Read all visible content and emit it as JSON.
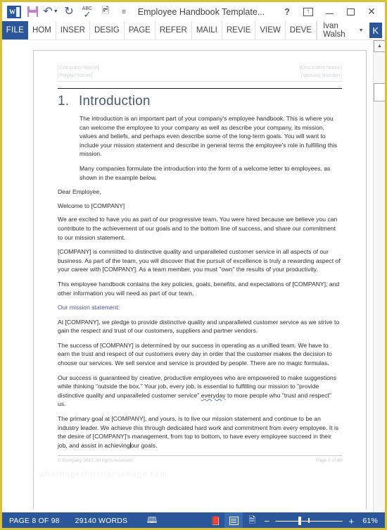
{
  "app": {
    "title": "Employee Handbook Template...",
    "quick_access": [
      {
        "name": "word-logo",
        "label": "W"
      },
      {
        "name": "save-icon",
        "label": "Save"
      },
      {
        "name": "undo-icon",
        "label": "Undo"
      },
      {
        "name": "redo-icon",
        "label": "Redo"
      },
      {
        "name": "spelling-icon",
        "label": "ABC"
      },
      {
        "name": "touch-mode-icon",
        "label": "Touch/Mouse Mode"
      },
      {
        "name": "customize-qat-icon",
        "label": "Customize Quick Access Toolbar"
      }
    ],
    "window_controls": [
      {
        "name": "help-button",
        "label": "?"
      },
      {
        "name": "ribbon-display-options-button",
        "label": "Ribbon Display Options"
      },
      {
        "name": "minimize-button",
        "label": "Minimize"
      },
      {
        "name": "maximize-button",
        "label": "Maximize"
      },
      {
        "name": "close-button",
        "label": "Close"
      }
    ]
  },
  "ribbon": {
    "file_tab": "FILE",
    "tabs": [
      "HOM",
      "INSER",
      "DESIG",
      "PAGE",
      "REFER",
      "MAILI",
      "REVIE",
      "VIEW",
      "DEVE"
    ],
    "user": "Ivan Walsh",
    "avatar_letter": "K"
  },
  "document": {
    "header": {
      "company": "[Company Name]",
      "project": "[Project Name]",
      "doc_name": "[Document Name]",
      "version": "[Version Number]"
    },
    "heading_number": "1.",
    "heading_text": "Introduction",
    "paragraphs": [
      "The introduction is an important part of your company's employee handbook. This is where you can welcome the employee to your company as well as describe your company, its mission, values and beliefs, and perhaps even describe some of the long-term goals. You will want to include your mission statement and describe in general terms the employee's role in fulfilling this mission.",
      "Many companies formulate the introduction into the form of a welcome letter to employees, as shown in the example below."
    ],
    "salutation": "Dear Employee,",
    "welcome": "Welcome to [COMPANY]",
    "body": [
      "We are excited to have you as part of our progressive team. You were hired because we believe you can contribute to the achievement of our goals and to the bottom line of success, and share our commitment to our mission statement.",
      "[COMPANY] is committed to distinctive quality and unparalleled customer service in all aspects of our business. As part of the team, you will discover that the pursuit of excellence is truly a rewarding aspect of your career with [COMPANY]. As a team member, you must \"own\" the results of your productivity.",
      "This employee handbook contains the key policies, goals, benefits, and expectations of [COMPANY]; and other information you will need as part of our team."
    ],
    "mission_label": "Our mission statement:",
    "mission_body": [
      "At [COMPANY], we pledge to provide distinctive quality and unparalleled customer service as we strive to gain the respect and trust of our customers, suppliers and partner vendors.",
      "The success of [COMPANY] is determined by our success in operating as a unified team. We have to earn the trust and respect of our customers every day in order that the customer makes the decision to choose our services. We sell service and service is provided by people. There are no magic formulas."
    ],
    "success_para_a": "Our success is guaranteed by creative, productive employees who are empowered to make suggestions while thinking \"outside the box.\" Your job, every job, is essential to fulfilling our mission to \"provide distinctive quality and unparalleled customer service\" ",
    "success_misspelled": "everyday",
    "success_para_b": " to more people who \"trust and respect\" us.",
    "final_para_a": "The primary goal at [COMPANY], and yours, is to live our mission statement and continue to be an industry leader. We achieve this through dedicated hard work and commitment from every employee. It is the desire of [COMPANY]'s management, from top to bottom, to have every employee succeed in their job, and assist in achieving",
    "final_para_b": "our goals.",
    "footer_left": "© Company 2017.  All rights reserved.",
    "footer_right": "Page 8 of 98",
    "watermark": "wheritagechristiancollege.com"
  },
  "statusbar": {
    "page_label": "PAGE 8 OF 98",
    "words_label": "29140 WORDS",
    "proofing_icon": "proofing-errors-icon",
    "read_mode_icon": "read-mode-icon",
    "print_layout_icon": "print-layout-icon",
    "web_layout_icon": "web-layout-icon",
    "zoom_out": "−",
    "zoom_in": "+",
    "zoom_level": "61%"
  }
}
